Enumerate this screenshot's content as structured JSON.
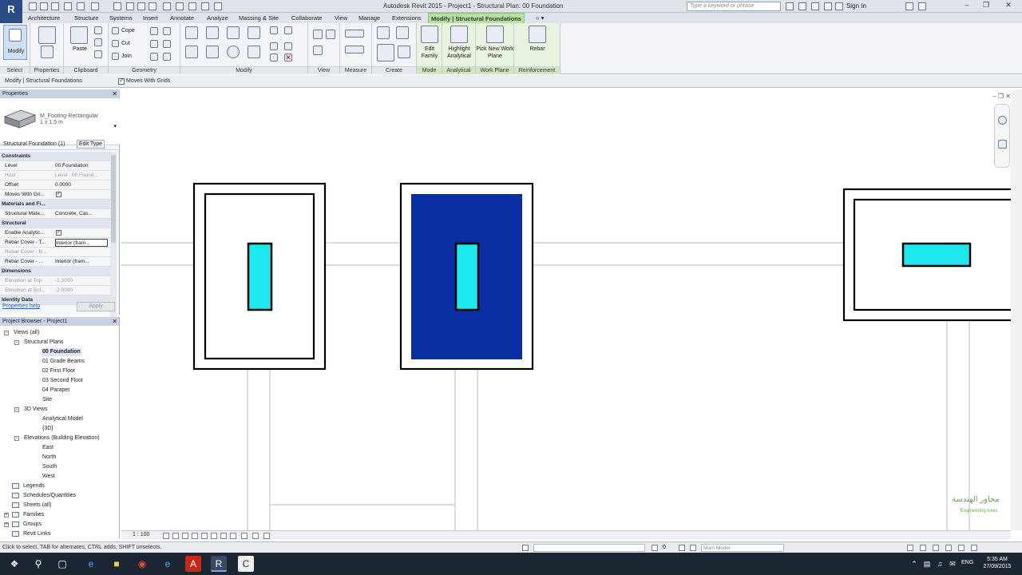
{
  "window": {
    "title": "Autodesk Revit 2015 -    Project1 - Structural Plan: 00 Foundation",
    "search_placeholder": "Type a keyword or phrase",
    "sign_in": "Sign In",
    "app_letter": "R"
  },
  "ribbon_tabs": [
    "Architecture",
    "Structure",
    "Systems",
    "Insert",
    "Annotate",
    "Analyze",
    "Massing & Site",
    "Collaborate",
    "View",
    "Manage",
    "Extensions",
    "Modify | Structural Foundations"
  ],
  "ribbon": {
    "groups": {
      "select": "Select",
      "properties": "Properties",
      "clipboard": "Clipboard",
      "geometry": "Geometry",
      "modify": "Modify",
      "view": "View",
      "measure": "Measure",
      "create": "Create",
      "mode": "Mode",
      "analytical": "Analytical",
      "work_plane": "Work Plane",
      "reinforcement": "Reinforcement"
    },
    "modify_label": "Modify",
    "paste_label": "Paste",
    "cope_label": "Cope",
    "cut_label": "Cut",
    "join_label": "Join",
    "edit_family": "Edit Family",
    "highlight_analytical": "Highlight Analytical",
    "pick_new_work_plane": "Pick New Work Plane",
    "rebar": "Rebar"
  },
  "options_bar": {
    "context": "Modify | Structural Foundations",
    "moves_with_grids": "Moves With Grids"
  },
  "properties": {
    "title": "Properties",
    "type_name": "M_Footing-Rectangular",
    "type_size": "1 x 1.5 m",
    "instance_filter": "Structural Foundation (1)",
    "edit_type": "Edit Type",
    "rows": [
      {
        "label": "Constraints",
        "cat": true
      },
      {
        "label": "Level",
        "value": "00 Foundation"
      },
      {
        "label": "Host",
        "value": "Level : 00 Found...",
        "grey": true
      },
      {
        "label": "Offset",
        "value": "0.0000"
      },
      {
        "label": "Moves With Gri...",
        "check": true
      },
      {
        "label": "Materials and Fi...",
        "cat": true
      },
      {
        "label": "Structural Mate...",
        "value": "Concrete, Cas..."
      },
      {
        "label": "Structural",
        "cat": true
      },
      {
        "label": "Enable Analytic...",
        "check": true
      },
      {
        "label": "Rebar Cover - T...",
        "value": "Interior (fram...",
        "sel": true
      },
      {
        "label": "Rebar Cover - B...",
        "value": "",
        "grey": true
      },
      {
        "label": "Rebar Cover - ...",
        "value": "Interior (fram..."
      },
      {
        "label": "Dimensions",
        "cat": true
      },
      {
        "label": "Elevation at Top",
        "value": "-1.3000",
        "grey": true
      },
      {
        "label": "Elevation at Bot...",
        "value": "-2.0000",
        "grey": true
      },
      {
        "label": "Identity Data",
        "cat": true
      }
    ],
    "help": "Properties help",
    "apply": "Apply"
  },
  "browser": {
    "title": "Project Browser - Project1",
    "nodes": [
      {
        "label": "Views (all)",
        "level": 1,
        "box": "-"
      },
      {
        "label": "Structural Plans",
        "level": 2,
        "box": "-"
      },
      {
        "label": "00 Foundation",
        "level": 3,
        "bold": true
      },
      {
        "label": "01 Grade Beams",
        "level": 3
      },
      {
        "label": "02 First Floor",
        "level": 3
      },
      {
        "label": "03 Second Floor",
        "level": 3
      },
      {
        "label": "04 Parapet",
        "level": 3
      },
      {
        "label": "Site",
        "level": 3
      },
      {
        "label": "3D Views",
        "level": 2,
        "box": "-"
      },
      {
        "label": "Analytical Model",
        "level": 3
      },
      {
        "label": "{3D}",
        "level": 3
      },
      {
        "label": "Elevations (Building Elevation)",
        "level": 2,
        "box": "-"
      },
      {
        "label": "East",
        "level": 3
      },
      {
        "label": "North",
        "level": 3
      },
      {
        "label": "South",
        "level": 3
      },
      {
        "label": "West",
        "level": 3
      },
      {
        "label": "Legends",
        "level": 1,
        "icon": true
      },
      {
        "label": "Schedules/Quantities",
        "level": 1,
        "icon": true
      },
      {
        "label": "Sheets (all)",
        "level": 1,
        "icon": true
      },
      {
        "label": "Families",
        "level": 1,
        "box": "+",
        "icon": true
      },
      {
        "label": "Groups",
        "level": 1,
        "box": "+",
        "icon": true
      },
      {
        "label": "Revit Links",
        "level": 1,
        "icon": true
      }
    ]
  },
  "canvas": {
    "selected_fill": "#0a2fa5",
    "column_fill": "#1de8ee",
    "watermark": "محاور الهندسة",
    "watermark_sub": "Engineering Axes"
  },
  "view_bar": {
    "scale": "1 : 100"
  },
  "status": {
    "text": "Click to select, TAB for alternates, CTRL adds, SHIFT unselects.",
    "model": "Main Model",
    "zero": ":0"
  },
  "taskbar": {
    "time": "5:35 AM",
    "date": "27/09/2015",
    "lang": "ENG",
    "icons": [
      "windows-icon",
      "search-icon",
      "task-view-icon",
      "edge-icon",
      "file-explorer-icon",
      "chrome-icon",
      "ie-icon",
      "acrobat-icon",
      "revit-icon",
      "camtasia-icon"
    ]
  }
}
